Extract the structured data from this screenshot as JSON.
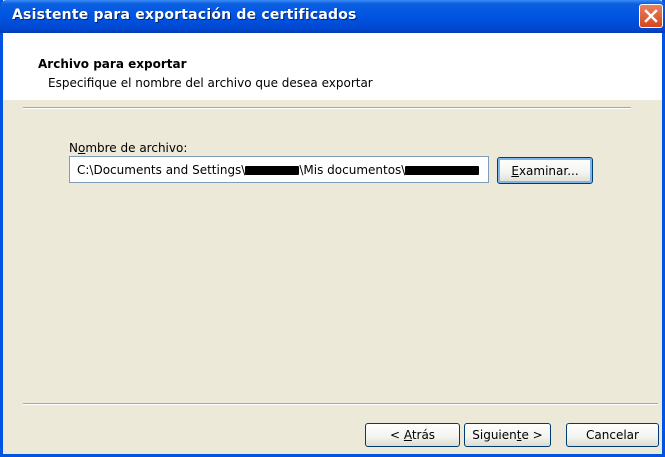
{
  "window": {
    "title": "Asistente para exportación de certificados"
  },
  "header": {
    "title": "Archivo para exportar",
    "subtitle": "Especifique el nombre del archivo que desea exportar"
  },
  "form": {
    "file_label_prefix": "N",
    "file_label_accel": "o",
    "file_label_rest": "mbre de archivo:",
    "path_part1": "C:\\Documents and Settings\\",
    "path_part2": "\\Mis documentos\\",
    "browse_label_accel": "E",
    "browse_label_rest": "xaminar..."
  },
  "footer": {
    "back_prefix": "< ",
    "back_accel": "A",
    "back_rest": "trás",
    "next_prefix": "Siguien",
    "next_accel": "t",
    "next_rest": "e >",
    "cancel_label": "Cancelar"
  },
  "colors": {
    "titlebar": "#0054e3",
    "dialog_bg": "#ece9d8",
    "close_button": "#d5461c"
  },
  "icons": {
    "close": "close-icon"
  }
}
